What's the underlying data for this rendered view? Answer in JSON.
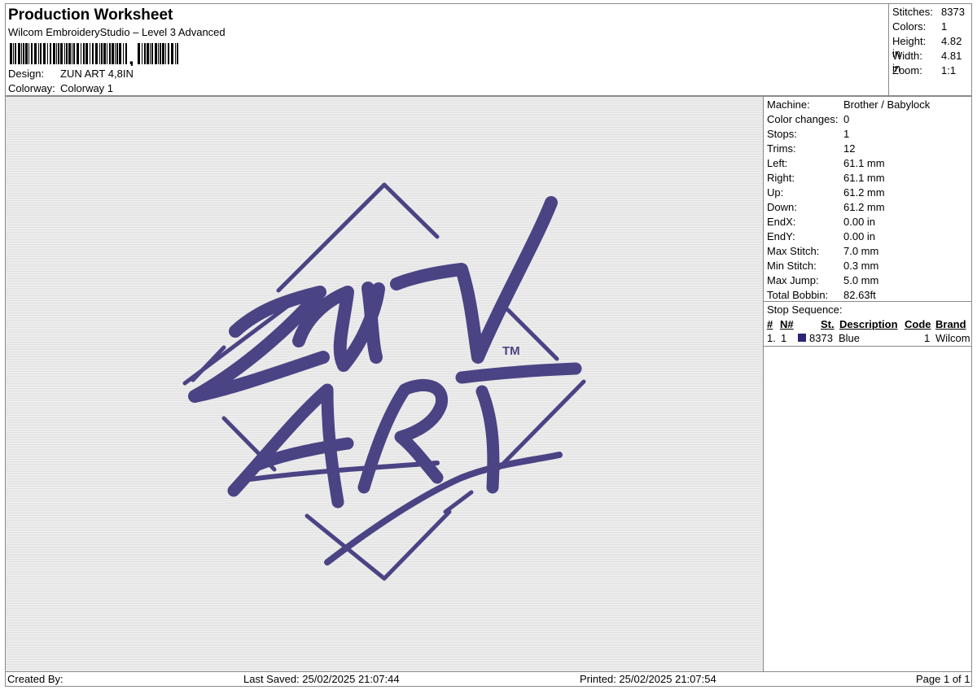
{
  "header": {
    "title": "Production Worksheet",
    "subtitle": "Wilcom EmbroideryStudio – Level 3 Advanced",
    "barcode_icon": "barcode-icon",
    "design_label": "Design:",
    "design_value": "ZUN ART 4,8IN",
    "colorway_label": "Colorway:",
    "colorway_value": "Colorway 1"
  },
  "stats": {
    "stitches_label": "Stitches:",
    "stitches_value": "8373",
    "colors_label": "Colors:",
    "colors_value": "1",
    "height_label": "Height:",
    "height_value": "4.82 in",
    "width_label": "Width:",
    "width_value": "4.81 in",
    "zoom_label": "Zoom:",
    "zoom_value": "1:1"
  },
  "design": {
    "tm_mark": "TM",
    "thread_color": "#4a4384",
    "fabric_color": "#ececec"
  },
  "info": {
    "rows": [
      {
        "label": "Machine:",
        "value": "Brother / Babylock"
      },
      {
        "label": "Color changes:",
        "value": "0"
      },
      {
        "label": "Stops:",
        "value": "1"
      },
      {
        "label": "Trims:",
        "value": "12"
      },
      {
        "label": "Left:",
        "value": "61.1 mm"
      },
      {
        "label": "Right:",
        "value": "61.1 mm"
      },
      {
        "label": "Up:",
        "value": "61.2 mm"
      },
      {
        "label": "Down:",
        "value": "61.2 mm"
      },
      {
        "label": "EndX:",
        "value": "0.00 in"
      },
      {
        "label": "EndY:",
        "value": "0.00 in"
      },
      {
        "label": "Max Stitch:",
        "value": "7.0 mm"
      },
      {
        "label": "Min Stitch:",
        "value": "0.3 mm"
      },
      {
        "label": "Max Jump:",
        "value": "5.0 mm"
      },
      {
        "label": "Total Bobbin:",
        "value": "82.63ft"
      }
    ]
  },
  "stop_sequence": {
    "title": "Stop Sequence:",
    "columns": [
      "#",
      "N#",
      "St.",
      "Description",
      "Code",
      "Brand"
    ],
    "rows": [
      {
        "index": "1.",
        "n": "1",
        "stitches": "8373",
        "description": "Blue",
        "code": "1",
        "brand": "Wilcom",
        "swatch": "#2a2577"
      }
    ]
  },
  "footer": {
    "created_by": "Created By:",
    "last_saved": "Last Saved: 25/02/2025 21:07:44",
    "printed": "Printed: 25/02/2025 21:07:54",
    "page": "Page 1 of 1"
  }
}
